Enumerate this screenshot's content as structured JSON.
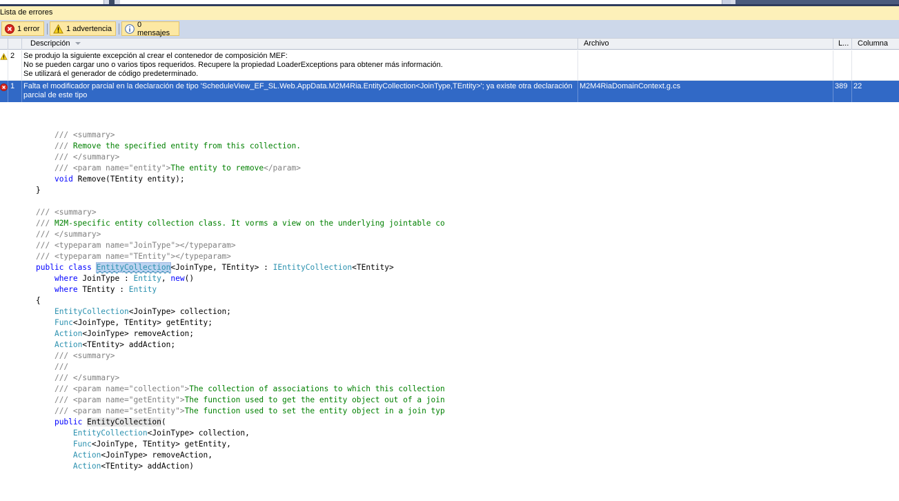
{
  "panel": {
    "title": "Lista de errores"
  },
  "toolbar": {
    "errors_label": "1 error",
    "warnings_label": "1 advertencia",
    "messages_label": "0 mensajes"
  },
  "columns": {
    "description": "Descripción",
    "file": "Archivo",
    "line": "L...",
    "column": "Columna"
  },
  "rows": [
    {
      "severity": "warning",
      "number": "2",
      "description_lines": [
        "Se produjo la siguiente excepción al crear el contenedor de composición MEF:",
        "No se pueden cargar uno o varios tipos requeridos. Recupere la propiedad LoaderExceptions para obtener más información.",
        "Se utilizará el generador de código predeterminado."
      ],
      "file": "",
      "line": "",
      "column": ""
    },
    {
      "severity": "error",
      "number": "1",
      "description_lines": [
        "Falta el modificador parcial en la declaración de tipo 'ScheduleView_EF_SL.Web.AppData.M2M4Ria.EntityCollection<JoinType,TEntity>'; ya existe otra declaración parcial de este tipo"
      ],
      "file": "M2M4RiaDomainContext.g.cs",
      "line": "389",
      "column": "22"
    }
  ],
  "code": {
    "l1_doc": "/// ",
    "l1_tag": "<summary>",
    "l2_doc": "/// ",
    "l2_text": "Remove the specified entity from this collection.",
    "l3_doc": "/// ",
    "l3_tag": "</summary>",
    "l4_doc": "/// ",
    "l4_tag_open": "<param name=\"entity\">",
    "l4_text": "The entity to remove",
    "l4_tag_close": "</param>",
    "l5_kw": "void",
    "l5_rest": " Remove(TEntity entity);",
    "l6": "}",
    "l8_doc": "/// ",
    "l8_tag": "<summary>",
    "l9_doc": "/// ",
    "l9_text": "M2M-specific entity collection class. It vorms a view on the underlying jointable co",
    "l10_doc": "/// ",
    "l10_tag": "</summary>",
    "l11_doc": "/// ",
    "l11_tag": "<typeparam name=\"JoinType\"></typeparam>",
    "l12_doc": "/// ",
    "l12_tag": "<typeparam name=\"TEntity\"></typeparam>",
    "l13_kw1": "public",
    "l13_kw2": "class",
    "l13_name": "EntityCollection",
    "l13_generic": "<JoinType, TEntity>",
    "l13_colon": " : ",
    "l13_iface": "IEntityCollection",
    "l13_iface_arg": "<TEntity>",
    "l14_kw": "where",
    "l14_mid": " JoinType : ",
    "l14_type": "Entity",
    "l14_comma": ", ",
    "l14_new": "new",
    "l14_paren": "()",
    "l15_kw": "where",
    "l15_mid": " TEntity : ",
    "l15_type": "Entity",
    "l16": "{",
    "l17_type": "EntityCollection",
    "l17_rest": "<JoinType> collection;",
    "l18_type": "Func",
    "l18_rest": "<JoinType, TEntity> getEntity;",
    "l19_type": "Action",
    "l19_rest": "<JoinType> removeAction;",
    "l20_type": "Action",
    "l20_rest": "<TEntity> addAction;",
    "l21_doc": "/// ",
    "l21_tag": "<summary>",
    "l22_doc": "///",
    "l23_doc": "/// ",
    "l23_tag": "</summary>",
    "l24_doc": "/// ",
    "l24_tag": "<param name=\"collection\">",
    "l24_text": "The collection of associations to which this collection",
    "l25_doc": "/// ",
    "l25_tag": "<param name=\"getEntity\">",
    "l25_text": "The function used to get the entity object out of a join",
    "l26_doc": "/// ",
    "l26_tag": "<param name=\"setEntity\">",
    "l26_text": "The function used to set the entity object in a join typ",
    "l27_kw": "public",
    "l27_name": "EntityCollection",
    "l27_paren": "(",
    "l28_type": "EntityCollection",
    "l28_rest": "<JoinType> collection,",
    "l29_type": "Func",
    "l29_rest": "<JoinType, TEntity> getEntity,",
    "l30_type": "Action",
    "l30_rest": "<JoinType> removeAction,",
    "l31_type": "Action",
    "l31_rest": "<TEntity> addAction)"
  }
}
